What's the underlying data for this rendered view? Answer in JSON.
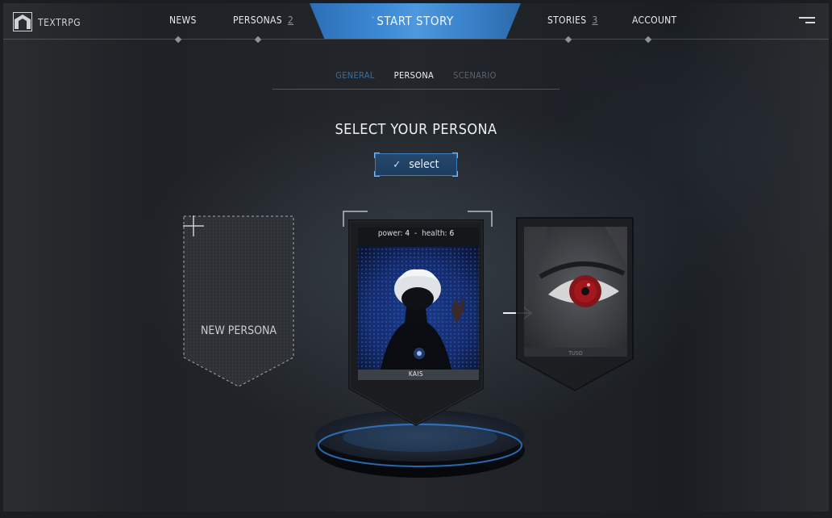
{
  "app": {
    "brand": "TEXTRPG"
  },
  "nav": {
    "news_label": "NEWS",
    "personas_label": "PERSONAS",
    "personas_count": "2",
    "start_story_label": "START STORY",
    "stories_label": "STORIES",
    "stories_count": "3",
    "account_label": "ACCOUNT"
  },
  "subtabs": [
    {
      "label": "GENERAL",
      "state": "done"
    },
    {
      "label": "PERSONA",
      "state": "active"
    },
    {
      "label": "SCENARIO",
      "state": "upcoming"
    }
  ],
  "page": {
    "heading": "SELECT YOUR PERSONA",
    "select_label": "select"
  },
  "new_persona": {
    "label": "NEW PERSONA",
    "icon": "plus-icon"
  },
  "personas": [
    {
      "name": "KAIS",
      "power_label": "power:",
      "power": "4",
      "health_label": "health:",
      "health": "6",
      "selected": true
    },
    {
      "name": "TUSO",
      "selected": false
    }
  ],
  "colors": {
    "accent": "#3d8ad6",
    "select_border": "#3a7ec4",
    "pedestal_glow": "#2f7fd6",
    "background": "#1e2125"
  }
}
